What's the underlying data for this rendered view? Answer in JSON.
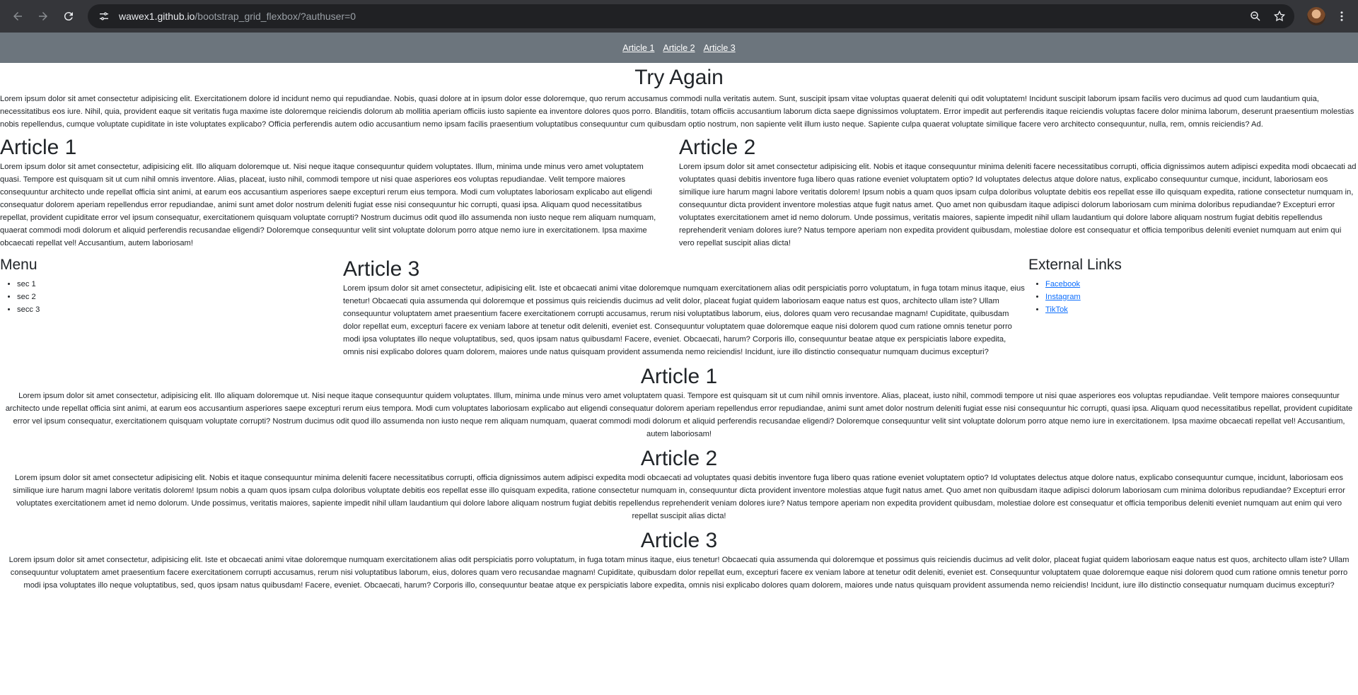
{
  "browser": {
    "url_host": "wawex1.github.io",
    "url_path": "/bootstrap_grid_flexbox/?authuser=0"
  },
  "topnav": {
    "links": [
      "Article 1",
      "Article 2",
      "Article 3"
    ]
  },
  "main_title": "Try Again",
  "intro_text": "Lorem ipsum dolor sit amet consectetur adipisicing elit. Exercitationem dolore id incidunt nemo qui repudiandae. Nobis, quasi dolore at in ipsum dolor esse doloremque, quo rerum accusamus commodi nulla veritatis autem. Sunt, suscipit ipsam vitae voluptas quaerat deleniti qui odit voluptatem! Incidunt suscipit laborum ipsam facilis vero ducimus ad quod cum laudantium quia, necessitatibus eos iure. Nihil, quia, provident eaque sit veritatis fuga maxime iste doloremque reiciendis dolorum ab mollitia aperiam officiis iusto sapiente ea inventore dolores quos porro. Blanditiis, totam officiis accusantium laborum dicta saepe dignissimos voluptatem. Error impedit aut perferendis itaque reiciendis voluptas facere dolor minima laborum, deserunt praesentium molestias nobis repellendus, cumque voluptate cupiditate in iste voluptates explicabo? Officia perferendis autem odio accusantium nemo ipsam facilis praesentium voluptatibus consequuntur cum quibusdam optio nostrum, non sapiente velit illum iusto neque. Sapiente culpa quaerat voluptate similique facere vero architecto consequuntur, nulla, rem, omnis reiciendis? Ad.",
  "row1": {
    "article1": {
      "title": "Article 1",
      "text": "Lorem ipsum dolor sit amet consectetur, adipisicing elit. Illo aliquam doloremque ut. Nisi neque itaque consequuntur quidem voluptates. Illum, minima unde minus vero amet voluptatem quasi. Tempore est quisquam sit ut cum nihil omnis inventore. Alias, placeat, iusto nihil, commodi tempore ut nisi quae asperiores eos voluptas repudiandae. Velit tempore maiores consequuntur architecto unde repellat officia sint animi, at earum eos accusantium asperiores saepe excepturi rerum eius tempora. Modi cum voluptates laboriosam explicabo aut eligendi consequatur dolorem aperiam repellendus error repudiandae, animi sunt amet dolor nostrum deleniti fugiat esse nisi consequuntur hic corrupti, quasi ipsa. Aliquam quod necessitatibus repellat, provident cupiditate error vel ipsum consequatur, exercitationem quisquam voluptate corrupti? Nostrum ducimus odit quod illo assumenda non iusto neque rem aliquam numquam, quaerat commodi modi dolorum et aliquid perferendis recusandae eligendi? Doloremque consequuntur velit sint voluptate dolorum porro atque nemo iure in exercitationem. Ipsa maxime obcaecati repellat vel! Accusantium, autem laboriosam!"
    },
    "article2": {
      "title": "Article 2",
      "text": "Lorem ipsum dolor sit amet consectetur adipisicing elit. Nobis et itaque consequuntur minima deleniti facere necessitatibus corrupti, officia dignissimos autem adipisci expedita modi obcaecati ad voluptates quasi debitis inventore fuga libero quas ratione eveniet voluptatem optio? Id voluptates delectus atque dolore natus, explicabo consequuntur cumque, incidunt, laboriosam eos similique iure harum magni labore veritatis dolorem! Ipsum nobis a quam quos ipsam culpa doloribus voluptate debitis eos repellat esse illo quisquam expedita, ratione consectetur numquam in, consequuntur dicta provident inventore molestias atque fugit natus amet. Quo amet non quibusdam itaque adipisci dolorum laboriosam cum minima doloribus repudiandae? Excepturi error voluptates exercitationem amet id nemo dolorum. Unde possimus, veritatis maiores, sapiente impedit nihil ullam laudantium qui dolore labore aliquam nostrum fugiat debitis repellendus reprehenderit veniam dolores iure? Natus tempore aperiam non expedita provident quibusdam, molestiae dolore est consequatur et officia temporibus deleniti eveniet numquam aut enim qui vero repellat suscipit alias dicta!"
    }
  },
  "row2": {
    "menu": {
      "title": "Menu",
      "items": [
        "sec 1",
        "sec 2",
        "secc 3"
      ]
    },
    "article3": {
      "title": "Article 3",
      "text": "Lorem ipsum dolor sit amet consectetur, adipisicing elit. Iste et obcaecati animi vitae doloremque numquam exercitationem alias odit perspiciatis porro voluptatum, in fuga totam minus itaque, eius tenetur! Obcaecati quia assumenda qui doloremque et possimus quis reiciendis ducimus ad velit dolor, placeat fugiat quidem laboriosam eaque natus est quos, architecto ullam iste? Ullam consequuntur voluptatem amet praesentium facere exercitationem corrupti accusamus, rerum nisi voluptatibus laborum, eius, dolores quam vero recusandae magnam! Cupiditate, quibusdam dolor repellat eum, excepturi facere ex veniam labore at tenetur odit deleniti, eveniet est. Consequuntur voluptatem quae doloremque eaque nisi dolorem quod cum ratione omnis tenetur porro modi ipsa voluptates illo neque voluptatibus, sed, quos ipsam natus quibusdam! Facere, eveniet. Obcaecati, harum? Corporis illo, consequuntur beatae atque ex perspiciatis labore expedita, omnis nisi explicabo dolores quam dolorem, maiores unde natus quisquam provident assumenda nemo reiciendis! Incidunt, iure illo distinctio consequatur numquam ducimus excepturi?"
    },
    "external": {
      "title": "External Links",
      "links": [
        "Facebook",
        "Instagram",
        "TikTok"
      ]
    }
  },
  "centered": [
    {
      "title": "Article 1",
      "text": "Lorem ipsum dolor sit amet consectetur, adipisicing elit. Illo aliquam doloremque ut. Nisi neque itaque consequuntur quidem voluptates. Illum, minima unde minus vero amet voluptatem quasi. Tempore est quisquam sit ut cum nihil omnis inventore. Alias, placeat, iusto nihil, commodi tempore ut nisi quae asperiores eos voluptas repudiandae. Velit tempore maiores consequuntur architecto unde repellat officia sint animi, at earum eos accusantium asperiores saepe excepturi rerum eius tempora. Modi cum voluptates laboriosam explicabo aut eligendi consequatur dolorem aperiam repellendus error repudiandae, animi sunt amet dolor nostrum deleniti fugiat esse nisi consequuntur hic corrupti, quasi ipsa. Aliquam quod necessitatibus repellat, provident cupiditate error vel ipsum consequatur, exercitationem quisquam voluptate corrupti? Nostrum ducimus odit quod illo assumenda non iusto neque rem aliquam numquam, quaerat commodi modi dolorum et aliquid perferendis recusandae eligendi? Doloremque consequuntur velit sint voluptate dolorum porro atque nemo iure in exercitationem. Ipsa maxime obcaecati repellat vel! Accusantium, autem laboriosam!"
    },
    {
      "title": "Article 2",
      "text": "Lorem ipsum dolor sit amet consectetur adipisicing elit. Nobis et itaque consequuntur minima deleniti facere necessitatibus corrupti, officia dignissimos autem adipisci expedita modi obcaecati ad voluptates quasi debitis inventore fuga libero quas ratione eveniet voluptatem optio? Id voluptates delectus atque dolore natus, explicabo consequuntur cumque, incidunt, laboriosam eos similique iure harum magni labore veritatis dolorem! Ipsum nobis a quam quos ipsam culpa doloribus voluptate debitis eos repellat esse illo quisquam expedita, ratione consectetur numquam in, consequuntur dicta provident inventore molestias atque fugit natus amet. Quo amet non quibusdam itaque adipisci dolorum laboriosam cum minima doloribus repudiandae? Excepturi error voluptates exercitationem amet id nemo dolorum. Unde possimus, veritatis maiores, sapiente impedit nihil ullam laudantium qui dolore labore aliquam nostrum fugiat debitis repellendus reprehenderit veniam dolores iure? Natus tempore aperiam non expedita provident quibusdam, molestiae dolore est consequatur et officia temporibus deleniti eveniet numquam aut enim qui vero repellat suscipit alias dicta!"
    },
    {
      "title": "Article 3",
      "text": "Lorem ipsum dolor sit amet consectetur, adipisicing elit. Iste et obcaecati animi vitae doloremque numquam exercitationem alias odit perspiciatis porro voluptatum, in fuga totam minus itaque, eius tenetur! Obcaecati quia assumenda qui doloremque et possimus quis reiciendis ducimus ad velit dolor, placeat fugiat quidem laboriosam eaque natus est quos, architecto ullam iste? Ullam consequuntur voluptatem amet praesentium facere exercitationem corrupti accusamus, rerum nisi voluptatibus laborum, eius, dolores quam vero recusandae magnam! Cupiditate, quibusdam dolor repellat eum, excepturi facere ex veniam labore at tenetur odit deleniti, eveniet est. Consequuntur voluptatem quae doloremque eaque nisi dolorem quod cum ratione omnis tenetur porro modi ipsa voluptates illo neque voluptatibus, sed, quos ipsam natus quibusdam! Facere, eveniet. Obcaecati, harum? Corporis illo, consequuntur beatae atque ex perspiciatis labore expedita, omnis nisi explicabo dolores quam dolorem, maiores unde natus quisquam provident assumenda nemo reiciendis! Incidunt, iure illo distinctio consequatur numquam ducimus excepturi?"
    }
  ]
}
